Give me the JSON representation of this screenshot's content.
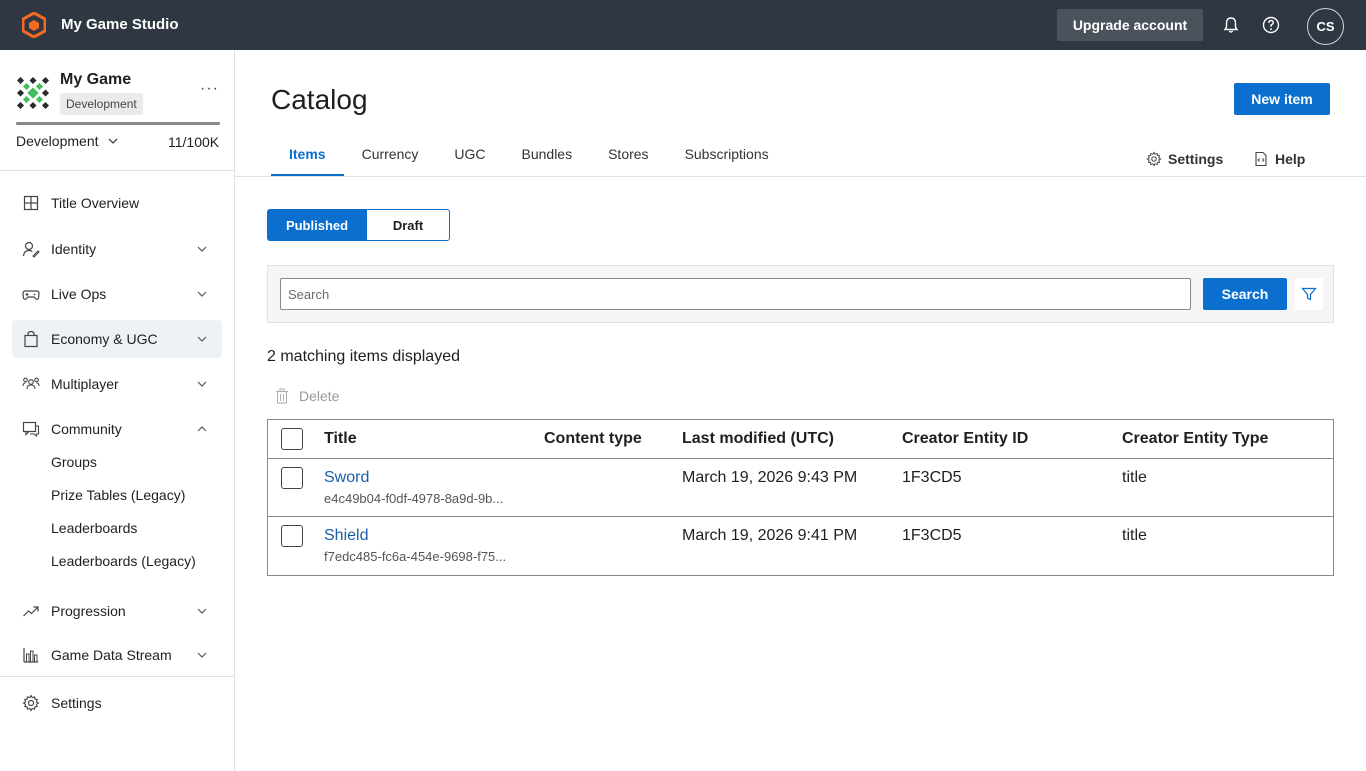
{
  "topbar": {
    "studio_name": "My Game Studio",
    "upgrade_label": "Upgrade account",
    "avatar_initials": "CS"
  },
  "sidebar": {
    "game_name": "My Game",
    "env_badge": "Development",
    "env_select": "Development",
    "usage_count": "11/100K",
    "usage_fraction": 0.00011,
    "nav": [
      {
        "label": "Title Overview"
      },
      {
        "label": "Identity"
      },
      {
        "label": "Live Ops"
      },
      {
        "label": "Economy & UGC"
      },
      {
        "label": "Multiplayer"
      },
      {
        "label": "Community"
      },
      {
        "label": "Progression"
      },
      {
        "label": "Game Data Stream"
      },
      {
        "label": "Settings"
      }
    ],
    "community_sub": [
      "Groups",
      "Prize Tables (Legacy)",
      "Leaderboards",
      "Leaderboards (Legacy)"
    ]
  },
  "main": {
    "title": "Catalog",
    "new_item_label": "New item",
    "tabs": [
      "Items",
      "Currency",
      "UGC",
      "Bundles",
      "Stores",
      "Subscriptions"
    ],
    "settings_label": "Settings",
    "help_label": "Help",
    "segment": {
      "published": "Published",
      "draft": "Draft"
    },
    "search_placeholder": "Search",
    "search_label": "Search",
    "match_count": "2 matching items displayed",
    "delete_label": "Delete",
    "table": {
      "headers": [
        "Title",
        "Content type",
        "Last modified (UTC)",
        "Creator Entity ID",
        "Creator Entity Type"
      ],
      "rows": [
        {
          "title": "Sword",
          "id": "e4c49b04-f0df-4978-8a9d-9b...",
          "content_type": "",
          "modified": "March 19, 2026 9:43 PM",
          "creator_id": "1F3CD5",
          "creator_type": "title"
        },
        {
          "title": "Shield",
          "id": "f7edc485-fc6a-454e-9698-f75...",
          "content_type": "",
          "modified": "March 19, 2026 9:41 PM",
          "creator_id": "1F3CD5",
          "creator_type": "title"
        }
      ]
    }
  },
  "colors": {
    "topbar": "#2f3742",
    "accent": "#0b6fcf",
    "brand_orange": "#f26b21",
    "link": "#1a5fa8"
  }
}
